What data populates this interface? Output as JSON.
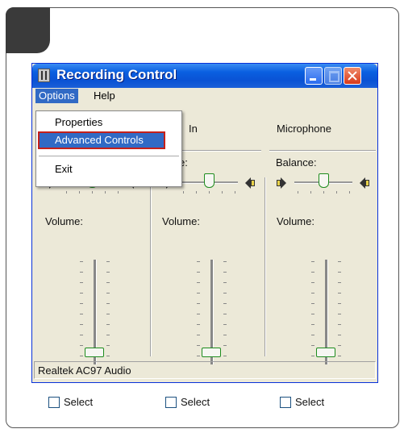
{
  "window": {
    "title": "Recording Control",
    "status": "Realtek AC97 Audio"
  },
  "menubar": {
    "items": [
      "Options",
      "Help"
    ]
  },
  "options_menu": {
    "items": [
      "Properties",
      "Advanced Controls",
      "Exit"
    ],
    "highlighted": "Advanced Controls"
  },
  "channels": [
    {
      "name": "",
      "balance_label": "",
      "volume_label": "Volume:",
      "select_label": "Select",
      "select_checked": false,
      "balance": 0.5,
      "volume": 0.06
    },
    {
      "name": "In",
      "balance_label": "ance:",
      "volume_label": "Volume:",
      "select_label": "Select",
      "select_checked": false,
      "balance": 0.5,
      "volume": 0.06
    },
    {
      "name": "Microphone",
      "balance_label": "Balance:",
      "volume_label": "Volume:",
      "select_label": "Select",
      "select_checked": false,
      "balance": 0.5,
      "volume": 0.06
    }
  ],
  "colors": {
    "titlebar": "#0a52d4",
    "window_bg": "#ece9d8",
    "menu_highlight": "#316ac5",
    "annotation_box": "#c4201a",
    "slider_thumb_border": "#1e8c1e"
  }
}
